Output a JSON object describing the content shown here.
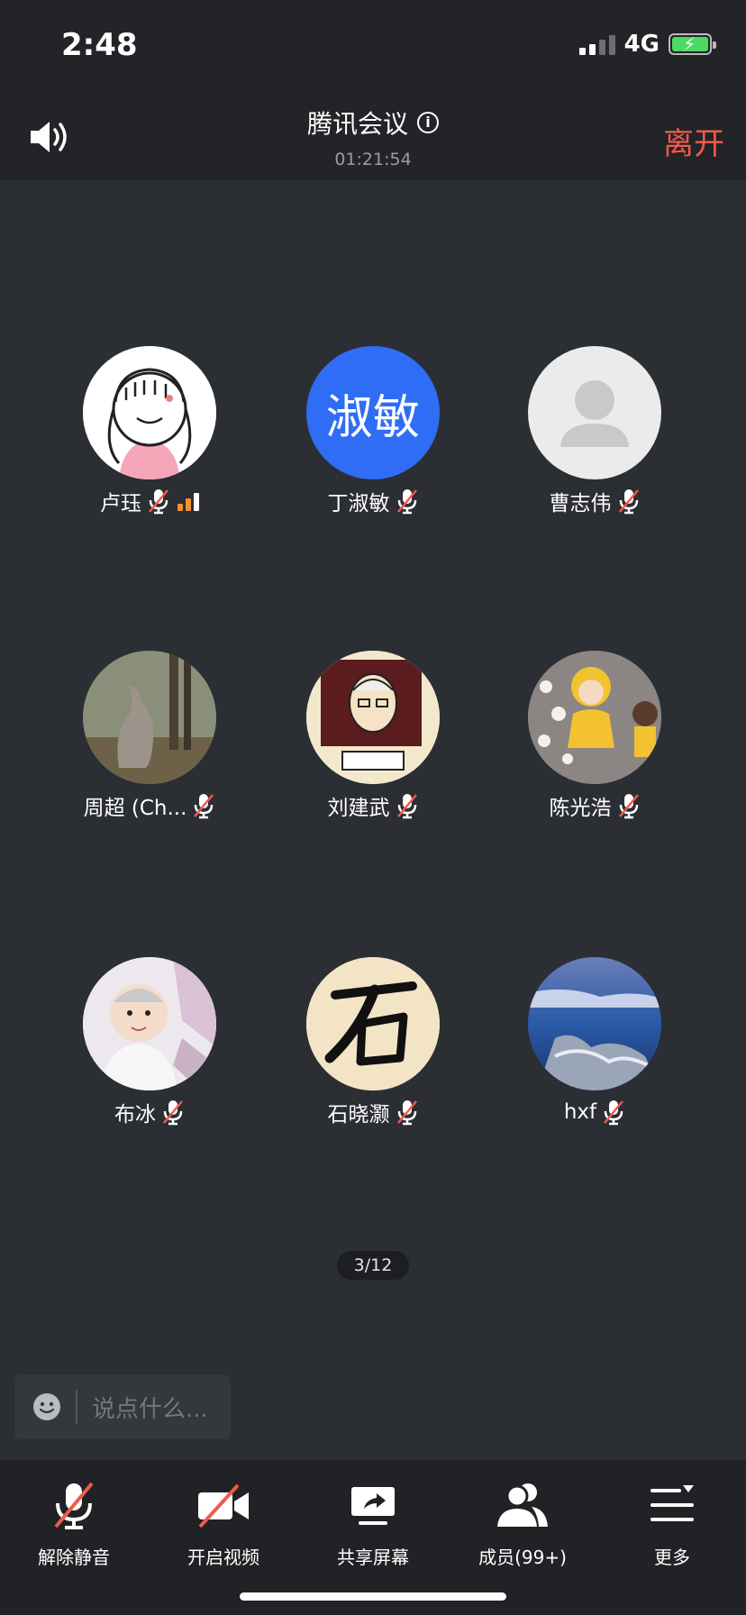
{
  "status_bar": {
    "time": "2:48",
    "network": "4G"
  },
  "header": {
    "title": "腾讯会议",
    "duration": "01:21:54",
    "leave_label": "离开"
  },
  "participants": [
    {
      "name": "卢珏",
      "avatar_text": "",
      "muted": true,
      "speaking": true
    },
    {
      "name": "丁淑敏",
      "avatar_text": "淑敏",
      "muted": true,
      "speaking": false
    },
    {
      "name": "曹志伟",
      "avatar_text": "",
      "muted": true,
      "speaking": false
    },
    {
      "name": "周超 (Ch...",
      "avatar_text": "",
      "muted": true,
      "speaking": false
    },
    {
      "name": "刘建武",
      "avatar_text": "",
      "muted": true,
      "speaking": false
    },
    {
      "name": "陈光浩",
      "avatar_text": "",
      "muted": true,
      "speaking": false
    },
    {
      "name": "布冰",
      "avatar_text": "",
      "muted": true,
      "speaking": false
    },
    {
      "name": "石晓灏",
      "avatar_text": "",
      "muted": true,
      "speaking": false
    },
    {
      "name": "hxf",
      "avatar_text": "",
      "muted": true,
      "speaking": false
    }
  ],
  "pagination": {
    "label": "3/12"
  },
  "chat": {
    "placeholder": "说点什么..."
  },
  "toolbar": {
    "unmute_label": "解除静音",
    "video_label": "开启视频",
    "share_label": "共享屏幕",
    "members_label": "成员(99+)",
    "more_label": "更多"
  },
  "colors": {
    "background": "#2b2e33",
    "bar": "#222427",
    "accent_red": "#ef5a4f",
    "avatar_blue": "#2f6df6",
    "speaking_orange": "#f0922d"
  }
}
